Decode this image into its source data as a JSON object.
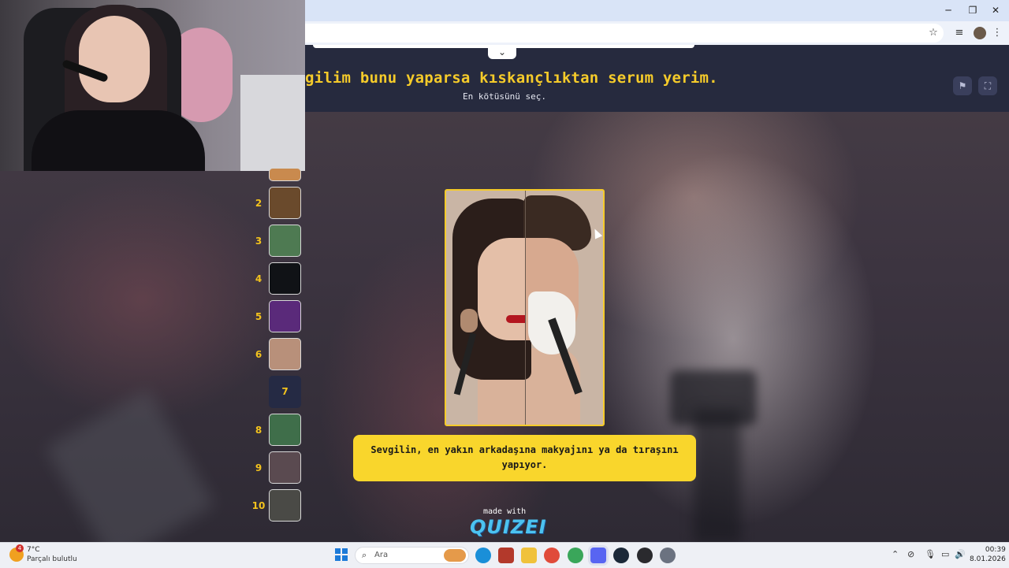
{
  "quiz": {
    "title": "gilim bunu yaparsa kıskançlıktan serum yerim.",
    "subtitle": "En kötüsünü seç.",
    "answer_text": "Sevgilin, en yakın arkadaşına makyajını ya da tıraşını yapıyor.",
    "made_with": "made with",
    "logo": "QUIZEI",
    "flag_icon": "flag-icon",
    "fullscreen_icon": "fullscreen-icon",
    "collapse_icon": "chevron-down-icon"
  },
  "thumbnails": [
    {
      "number": "2",
      "color": "#6a4a2c"
    },
    {
      "number": "3",
      "color": "#4e7a52"
    },
    {
      "number": "4",
      "color": "#101216"
    },
    {
      "number": "5",
      "color": "#5a2a7a"
    },
    {
      "number": "6",
      "color": "#b8907a"
    },
    {
      "number": "7",
      "active": true
    },
    {
      "number": "8",
      "color": "#3f6e4a"
    },
    {
      "number": "9",
      "color": "#5a4a50"
    },
    {
      "number": "10",
      "color": "#4a4a46"
    }
  ],
  "browser": {
    "minimize": "─",
    "restore": "❐",
    "close": "✕",
    "star_icon": "☆",
    "menu_icon": "⋮",
    "media_icon": "≡"
  },
  "taskbar": {
    "weather_temp": "7°C",
    "weather_desc": "Parçalı bulutlu",
    "weather_badge": "4",
    "search_placeholder": "Ara",
    "time": "00:39",
    "date": "8.01.2026",
    "apps": [
      {
        "name": "edge-icon",
        "color": "#1a8fd8"
      },
      {
        "name": "game-icon",
        "color": "#b3392b"
      },
      {
        "name": "file-explorer-icon",
        "color": "#f0c23b"
      },
      {
        "name": "chrome-icon",
        "color": "#e04b3a"
      },
      {
        "name": "chrome-profile-icon",
        "color": "#3aa65a"
      },
      {
        "name": "discord-icon",
        "color": "#5865f2"
      },
      {
        "name": "steam-icon",
        "color": "#1b2838"
      },
      {
        "name": "obs-icon",
        "color": "#2a2a2e"
      },
      {
        "name": "settings-icon",
        "color": "#6b7280"
      }
    ]
  }
}
